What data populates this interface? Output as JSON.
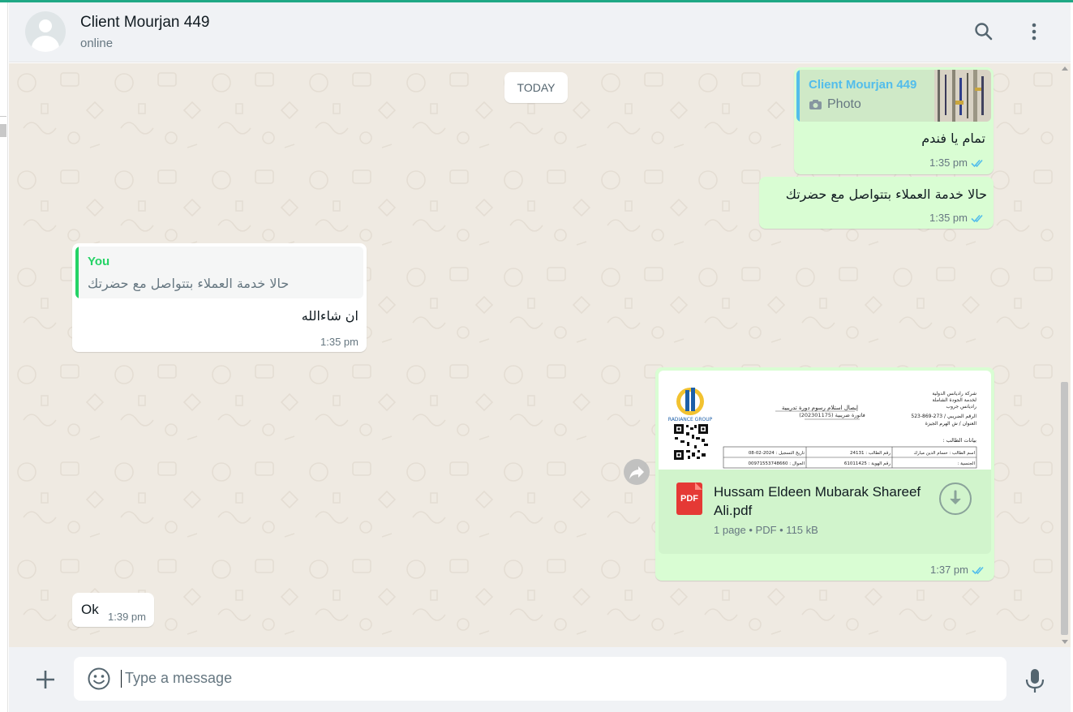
{
  "header": {
    "contact_name": "Client Mourjan 449",
    "status": "online",
    "icons": [
      "search-icon",
      "menu-dots-icon"
    ]
  },
  "chat": {
    "date_separator": "TODAY",
    "messages": [
      {
        "direction": "out",
        "quote_author": "Client Mourjan 449",
        "quote_text": "Photo",
        "text": "تمام يا فندم",
        "time": "1:35 pm",
        "status": "read"
      },
      {
        "direction": "out",
        "text": "حالا خدمة العملاء بتتواصل مع حضرتك",
        "time": "1:35 pm",
        "status": "read"
      },
      {
        "direction": "in",
        "quote_author": "You",
        "quote_text": "حالا خدمة العملاء بتتواصل مع حضرتك",
        "text": "ان شاءالله",
        "time": "1:35 pm"
      },
      {
        "direction": "out",
        "document": {
          "name": "Hussam Eldeen Mubarak Shareef Ali.pdf",
          "info": "1 page • PDF • 115 kB",
          "type_label": "PDF",
          "preview": {
            "company_lines": [
              "شركة راديانس الدولية",
              "لخدمة الجودة الشاملة",
              "راديانس جروب"
            ],
            "heading": "إيصال استلام رسوم دورة تدريبية",
            "invoice": "فاتورة ضريبية (202301175)",
            "tax_no": "الرقم الضريبي / 273-869-523",
            "address": "العنوان / ش الهرم الجيزة",
            "section": "بيانات الطالب :",
            "logo_text": "RADIANCE GROUP",
            "rows": [
              [
                "اسم الطالب : حسام الدين مبارك",
                "رقم الطالب : 24131",
                "تاريخ التسجيل : 2024-02-08"
              ],
              [
                "الجنسية :",
                "رقم الهوية : 61011425",
                "الجوال : 00971553748660"
              ]
            ]
          }
        },
        "time": "1:37 pm",
        "status": "read"
      },
      {
        "direction": "in",
        "text": "Ok",
        "time": "1:39 pm"
      }
    ]
  },
  "composer": {
    "placeholder": "Type a message",
    "icons": [
      "plus-icon",
      "emoji-icon",
      "microphone-icon"
    ]
  },
  "colors": {
    "accent": "#1fa885",
    "outgoing_bubble": "#d9fdd3",
    "incoming_bubble": "#ffffff",
    "chat_background": "#efeae2",
    "read_ticks": "#53bdeb"
  }
}
